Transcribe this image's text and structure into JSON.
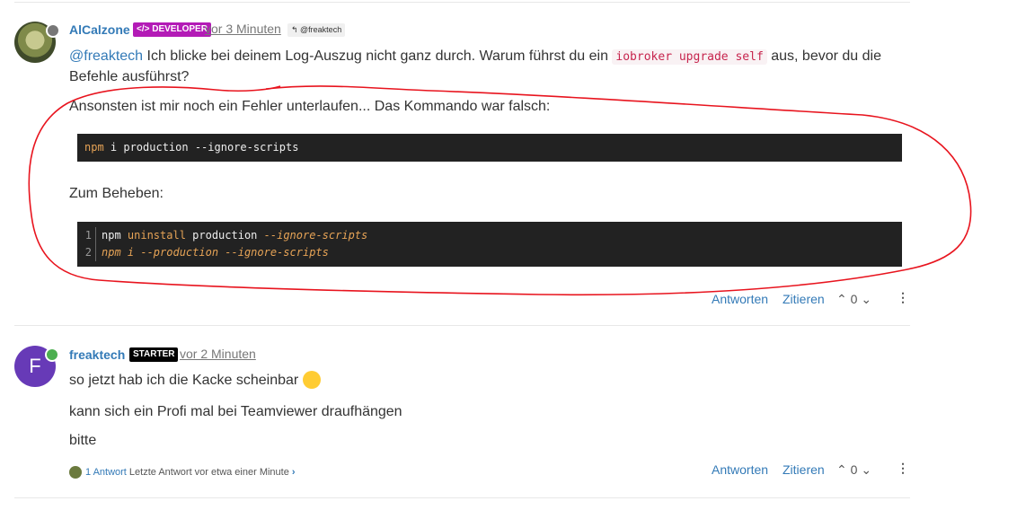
{
  "post1": {
    "username": "AlCalzone",
    "badge": "</> DEVELOPER",
    "time": "vor 3 Minuten",
    "reply_to": "↰ @freaktech",
    "line1_mention": "@freaktech",
    "line1_text_a": " Ich blicke bei deinem Log-Auszug nicht ganz durch. Warum führst du ein ",
    "line1_code": "iobroker upgrade self",
    "line1_text_b": " aus, bevor du die",
    "line2": "Befehle ausführst?",
    "line3": "Ansonsten ist mir noch ein Fehler unterlaufen... Das Kommando war falsch:",
    "code1": {
      "cmd": "npm",
      "rest": " i production --ignore-scripts"
    },
    "fix_label": "Zum Beheben:",
    "code2": [
      {
        "num": "1",
        "cmd": "npm",
        "kw": " uninstall",
        "mid": " production",
        "flag": " --ignore-scripts"
      },
      {
        "num": "2",
        "cmd": "npm i --production --ignore-scripts"
      }
    ],
    "actions": {
      "reply": "Antworten",
      "quote": "Zitieren",
      "votes": "0"
    }
  },
  "post2": {
    "avatar_letter": "F",
    "username": "freaktech",
    "badge": "STARTER",
    "time": "vor 2 Minuten",
    "line1": "so jetzt hab ich die Kacke scheinbar",
    "line2": "kann sich ein Profi mal bei Teamviewer draufhängen",
    "line3": "bitte",
    "replies_count": "1 Antwort",
    "replies_last": " Letzte Antwort vor etwa einer Minute",
    "actions": {
      "reply": "Antworten",
      "quote": "Zitieren",
      "votes": "0"
    }
  },
  "colors": {
    "accent": "#337ab7",
    "developer_badge": "#b31bb6",
    "starter_badge": "#000000",
    "online": "#4caf50",
    "annotation": "#e8141e"
  }
}
